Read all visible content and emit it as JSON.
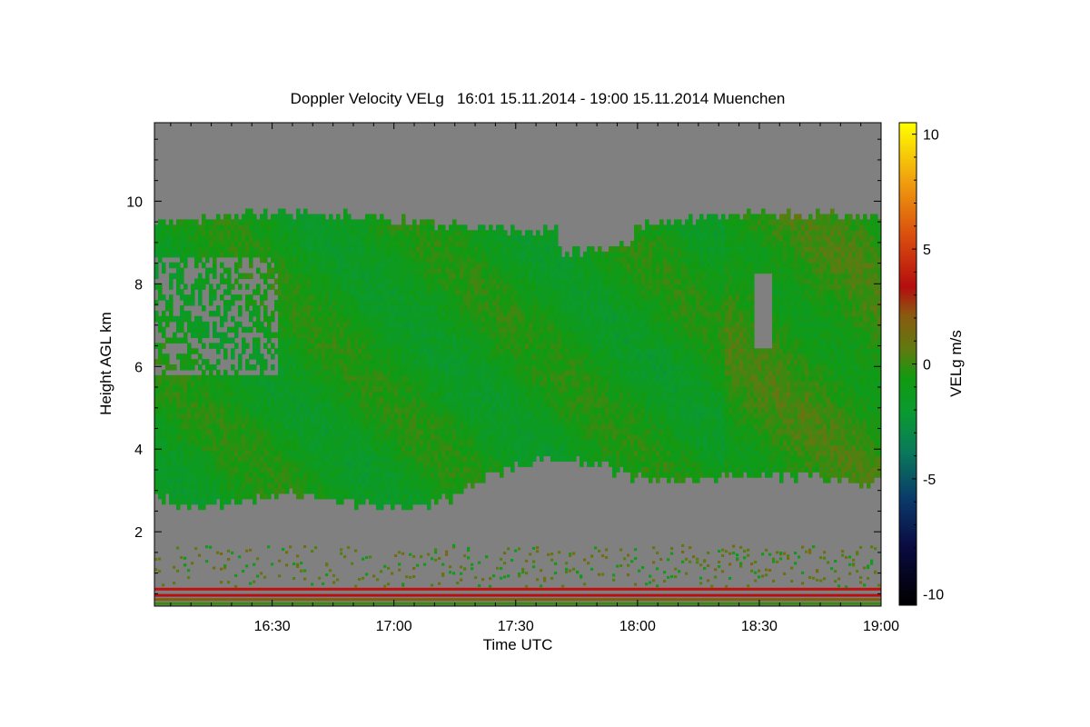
{
  "chart_data": {
    "type": "heatmap",
    "title": "Doppler Velocity VELg   16:01 15.11.2014 - 19:00 15.11.2014 Muenchen",
    "xlabel": "Time UTC",
    "ylabel": "Height AGL km",
    "colorbar_label": "VELg m/s",
    "x_range": [
      "16:01",
      "19:00"
    ],
    "x_ticks": [
      "16:30",
      "17:00",
      "17:30",
      "18:00",
      "18:30",
      "19:00"
    ],
    "ylim": [
      0.2,
      11.9
    ],
    "y_ticks": [
      2,
      4,
      6,
      8,
      10
    ],
    "colorbar_range": [
      -10.5,
      10.5
    ],
    "colorbar_ticks": [
      10,
      5,
      0,
      -5,
      -10
    ],
    "colormap": [
      "#000000",
      "#0a0a40",
      "#0a3a6a",
      "#0a7a5a",
      "#0a9a30",
      "#119a11",
      "#5f7a10",
      "#8a5a10",
      "#b40e0e",
      "#d84a0e",
      "#f0a00e",
      "#ffff00"
    ],
    "no_data_color": "#808080",
    "cloud_layer": {
      "description_units": "km",
      "base_height_range": [
        2.3,
        3.8
      ],
      "top_height_range": [
        8.5,
        9.9
      ],
      "typical_velocity_range": [
        -2.5,
        1.5
      ]
    },
    "boundary_layer_lines_km": [
      0.25,
      0.35,
      0.45,
      0.6
    ]
  }
}
